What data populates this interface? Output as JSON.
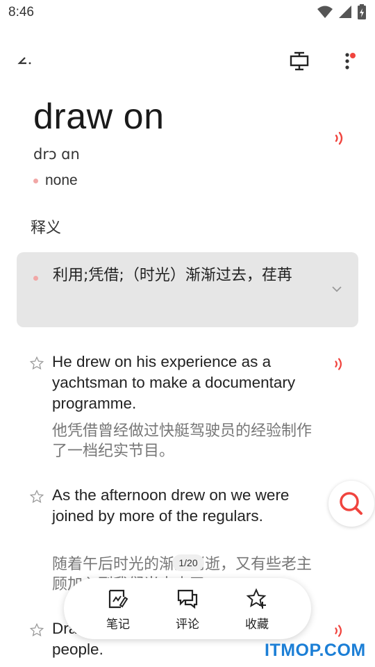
{
  "status": {
    "time": "8:46"
  },
  "word": {
    "title": "draw on",
    "phonetic": "drɔ ɑn",
    "tag": "none"
  },
  "section_label": "释义",
  "definition": {
    "text": "利用;凭借;（时光）渐渐过去，荏苒"
  },
  "examples": [
    {
      "en": "He drew on his experience as a yachtsman to make a documentary programme.",
      "cn": "他凭借曾经做过快艇驾驶员的经验制作了一档纪实节目。"
    },
    {
      "en": "As the afternoon drew on we were joined by more of the regulars.",
      "cn": "随着午后时光的渐渐消逝，又有些老主顾加入到我们当中来了。"
    },
    {
      "en": "Draw on the experience of other people.",
      "cn": ""
    }
  ],
  "page_indicator": "1/20",
  "bottom_bar": {
    "note_label": "笔记",
    "comment_label": "评论",
    "favorite_label": "收藏"
  },
  "watermark": "ITMOP.COM",
  "colors": {
    "accent_red": "#f0443e",
    "pink_dot": "#f1a7a6",
    "watermark_blue": "#1c7fd6",
    "card_bg": "#e6e6e6"
  },
  "icons": {
    "back": "back-arrow-icon",
    "screen": "screen-display-icon",
    "more": "more-vertical-icon",
    "speaker": "speaker-icon",
    "star": "star-outline-icon",
    "chevron": "chevron-down-icon",
    "search": "search-icon",
    "note": "note-edit-icon",
    "comment": "comment-icon",
    "favorite": "star-add-icon"
  }
}
